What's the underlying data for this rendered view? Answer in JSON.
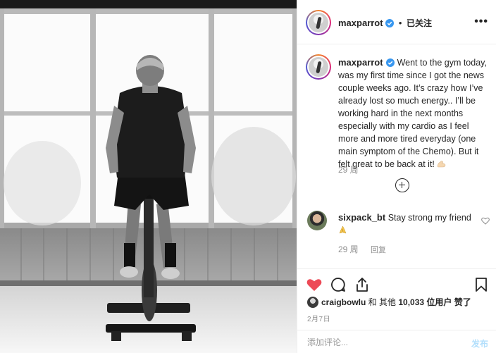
{
  "post": {
    "username": "maxparrot",
    "follow_status": "已关注",
    "more_label": "•••",
    "caption": "Went to the gym today, was my first time since I got the news couple weeks ago. It’s crazy how I’ve already lost so much energy.. I’ll be working hard in the next months especially with my cardio as I feel more and more tired everyday (one main symptom of the Chemo). But it felt great to be back at it!",
    "caption_emoji": "flexed-biceps",
    "time_ago": "29 周"
  },
  "comment": {
    "username": "sixpack_bt",
    "text": "Stay strong my friend",
    "emoji": "folded-hands",
    "time_ago": "29 周",
    "reply_label": "回复"
  },
  "likes": {
    "liker": "craigbowlu",
    "text_mid": " 和 其他 ",
    "count": "10,033",
    "text_end": " 位用户 赞了"
  },
  "date": "2月7日",
  "composer": {
    "placeholder": "添加评论...",
    "post_label": "发布"
  },
  "colors": {
    "like_red": "#ed4956",
    "verified_blue": "#3897f0",
    "muted_text": "#8e8e8e",
    "post_disabled": "#b2dffc"
  }
}
